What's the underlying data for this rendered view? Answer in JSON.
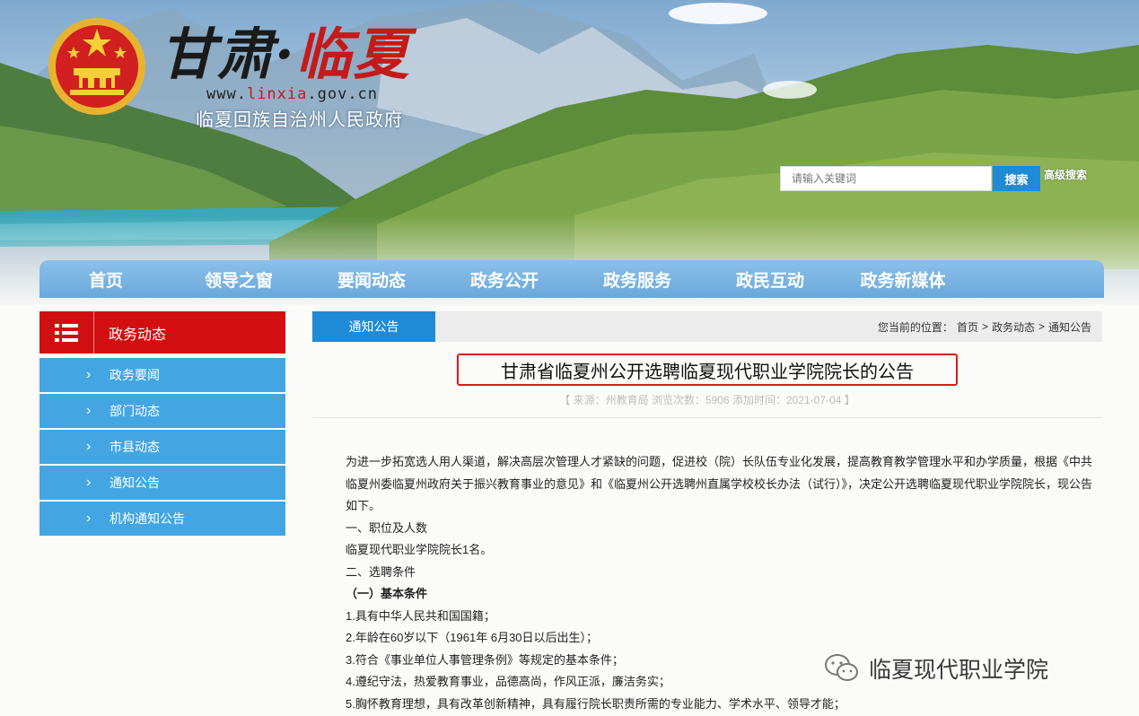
{
  "header": {
    "title_part1": "甘肃",
    "title_sep": "·",
    "title_part2": "临夏",
    "url_prefix": "www.",
    "url_domain": "linxia",
    "url_suffix": ".gov.cn",
    "subtitle": "临夏回族自治州人民政府",
    "search_placeholder": "请输入关键词",
    "search_button": "搜索",
    "advanced_search": "高级搜索"
  },
  "nav": {
    "items": [
      "首页",
      "领导之窗",
      "要闻动态",
      "政务公开",
      "政务服务",
      "政民互动",
      "政务新媒体"
    ]
  },
  "sidebar": {
    "title": "政务动态",
    "items": [
      {
        "label": "政务要闻"
      },
      {
        "label": "部门动态"
      },
      {
        "label": "市县动态"
      },
      {
        "label": "通知公告"
      },
      {
        "label": "机构通知公告"
      }
    ]
  },
  "content": {
    "tab": "通知公告",
    "breadcrumb": {
      "prefix": "您当前的位置：",
      "items": [
        "首页",
        "政务动态",
        "通知公告"
      ],
      "separator": ">"
    },
    "headline": "甘肃省临夏州公开选聘临夏现代职业学院院长的公告",
    "meta": "【 来源：州教育局 浏览次数：5906 添加时间：2021-07-04 】",
    "paragraphs": [
      "为进一步拓宽选人用人渠道，解决高层次管理人才紧缺的问题，促进校（院）长队伍专业化发展，提高教育教学管理水平和办学质量，根据《中共临夏州委临夏州政府关于振兴教育事业的意见》和《临夏州公开选聘州直属学校校长办法（试行）》，决定公开选聘临夏现代职业学院院长，现公告如下。",
      "一、职位及人数",
      "临夏现代职业学院院长1名。",
      "二、选聘条件",
      "（一）基本条件",
      "1.具有中华人民共和国国籍；",
      "2.年龄在60岁以下（1961年 6月30日以后出生）；",
      "3.符合《事业单位人事管理条例》等规定的基本条件；",
      "4.遵纪守法，热爱教育事业，品德高尚，作风正派，廉洁务实；",
      "5.胸怀教育理想，具有改革创新精神，具有履行院长职责所需的专业能力、学术水平、领导才能；"
    ]
  },
  "watermark": {
    "text": "临夏现代职业学院",
    "icon": "wechat-icon"
  },
  "colors": {
    "nav": "#6aa8da",
    "sidebar_head": "#d20f10",
    "sidebar_item": "#43a6e3",
    "accent_blue": "#1f8ad6",
    "highlight_red": "#e0191b"
  }
}
